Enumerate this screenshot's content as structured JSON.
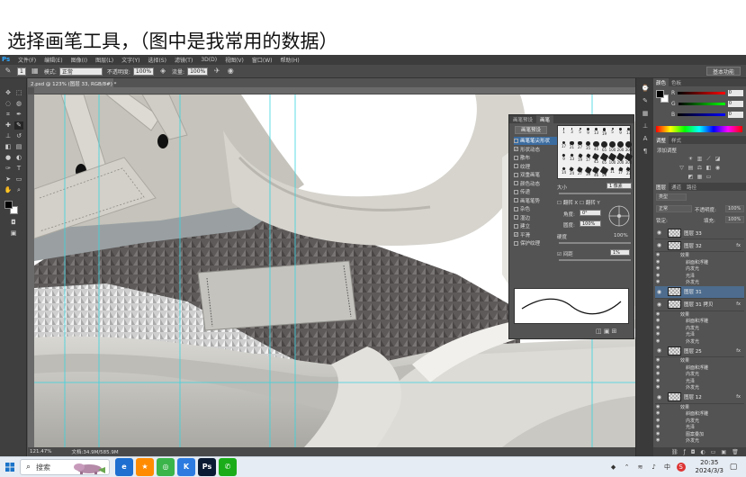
{
  "caption": "选择画笔工具，（图中是我常用的数据）",
  "ps": {
    "app_logo": "Ps",
    "menu": [
      "文件(F)",
      "编辑(E)",
      "图像(I)",
      "图层(L)",
      "文字(Y)",
      "选择(S)",
      "滤镜(T)",
      "3D(D)",
      "视图(V)",
      "窗口(W)",
      "帮助(H)"
    ],
    "options": {
      "brush_size": "1",
      "mode_label": "模式:",
      "mode_value": "正常",
      "opacity_label": "不透明度:",
      "opacity_value": "100%",
      "flow_label": "流量:",
      "flow_value": "100%"
    },
    "workspace_button": "基本功能",
    "document_tab": "2.psd @ 123% (图层 33, RGB/8#) *",
    "status": {
      "zoom": "121.47%",
      "doc_info": "文档:34.9M/585.9M"
    },
    "brush_panel": {
      "tabs": [
        "画笔预设",
        "画笔"
      ],
      "preset_button": "画笔预设",
      "categories": [
        {
          "label": "画笔笔尖形状",
          "checked": false,
          "selected": true
        },
        {
          "label": "形状动态",
          "checked": true,
          "selected": false
        },
        {
          "label": "散布",
          "checked": false,
          "selected": false
        },
        {
          "label": "纹理",
          "checked": false,
          "selected": false
        },
        {
          "label": "双重画笔",
          "checked": false,
          "selected": false
        },
        {
          "label": "颜色动态",
          "checked": false,
          "selected": false
        },
        {
          "label": "传递",
          "checked": false,
          "selected": false
        },
        {
          "label": "画笔笔势",
          "checked": false,
          "selected": false
        },
        {
          "label": "杂色",
          "checked": false,
          "selected": false
        },
        {
          "label": "湿边",
          "checked": false,
          "selected": false
        },
        {
          "label": "建立",
          "checked": false,
          "selected": false
        },
        {
          "label": "平滑",
          "checked": true,
          "selected": false
        },
        {
          "label": "保护纹理",
          "checked": false,
          "selected": false
        }
      ],
      "tips": [
        "1",
        "3",
        "5",
        "9",
        "13",
        "19",
        "5",
        "9",
        "13",
        "17",
        "21",
        "27",
        "35",
        "45",
        "65",
        "100",
        "200",
        "300",
        "9",
        "13",
        "19",
        "17",
        "45",
        "65",
        "100",
        "200",
        "300",
        "14",
        "24",
        "27",
        "39",
        "46",
        "59",
        "11",
        "17",
        "23"
      ],
      "size_label": "大小",
      "size_value": "1 像素",
      "flip_x_label": "翻转 X",
      "flip_y_label": "翻转 Y",
      "angle_label": "角度:",
      "angle_value": "0°",
      "roundness_label": "圆度:",
      "roundness_value": "100%",
      "hardness_label": "硬度",
      "hardness_value": "100%",
      "spacing_label": "间距",
      "spacing_value": "1%"
    },
    "color_panel": {
      "tabs": [
        "颜色",
        "色板"
      ],
      "r_label": "R",
      "r_value": "0",
      "g_label": "G",
      "g_value": "0",
      "b_label": "B",
      "b_value": "0"
    },
    "adjust_panel": {
      "tabs": [
        "调整",
        "样式"
      ],
      "add_label": "添加调整"
    },
    "layers_panel": {
      "tabs": [
        "图层",
        "通道",
        "路径"
      ],
      "kind_label": "类型",
      "blend_mode": "正常",
      "opacity_label": "不透明度:",
      "opacity_value": "100%",
      "lock_label": "锁定:",
      "fill_label": "填充:",
      "fill_value": "100%",
      "fx_mark": "fx",
      "rows": [
        {
          "type": "layer",
          "name": "图层 33",
          "selected": false,
          "fx": false
        },
        {
          "type": "layer",
          "name": "图层 32",
          "selected": false,
          "fx": true
        },
        {
          "type": "effect",
          "name": "效果",
          "level": 1
        },
        {
          "type": "effect",
          "name": "斜面和浮雕",
          "level": 2
        },
        {
          "type": "effect",
          "name": "内发光",
          "level": 2
        },
        {
          "type": "effect",
          "name": "光泽",
          "level": 2
        },
        {
          "type": "effect",
          "name": "外发光",
          "level": 2
        },
        {
          "type": "layer",
          "name": "图层 31",
          "selected": true,
          "fx": false
        },
        {
          "type": "layer",
          "name": "图层 31 拷贝",
          "selected": false,
          "fx": true
        },
        {
          "type": "effect",
          "name": "效果",
          "level": 1
        },
        {
          "type": "effect",
          "name": "斜面和浮雕",
          "level": 2
        },
        {
          "type": "effect",
          "name": "内发光",
          "level": 2
        },
        {
          "type": "effect",
          "name": "光泽",
          "level": 2
        },
        {
          "type": "effect",
          "name": "外发光",
          "level": 2
        },
        {
          "type": "layer",
          "name": "图层 25",
          "selected": false,
          "fx": true
        },
        {
          "type": "effect",
          "name": "效果",
          "level": 1
        },
        {
          "type": "effect",
          "name": "斜面和浮雕",
          "level": 2
        },
        {
          "type": "effect",
          "name": "内发光",
          "level": 2
        },
        {
          "type": "effect",
          "name": "光泽",
          "level": 2
        },
        {
          "type": "effect",
          "name": "外发光",
          "level": 2
        },
        {
          "type": "layer",
          "name": "图层 12",
          "selected": false,
          "fx": true
        },
        {
          "type": "effect",
          "name": "效果",
          "level": 1
        },
        {
          "type": "effect",
          "name": "斜面和浮雕",
          "level": 2
        },
        {
          "type": "effect",
          "name": "内发光",
          "level": 2
        },
        {
          "type": "effect",
          "name": "光泽",
          "level": 2
        },
        {
          "type": "effect",
          "name": "图案叠加",
          "level": 2
        },
        {
          "type": "effect",
          "name": "外发光",
          "level": 2
        }
      ]
    }
  },
  "taskbar": {
    "search_placeholder": "搜索",
    "time": "20:35",
    "date": "2024/3/3",
    "ime_label": "中",
    "apps": [
      {
        "name": "edge",
        "glyph": "e",
        "color": "#1e6fd0"
      },
      {
        "name": "store",
        "glyph": "★",
        "color": "#ff8c00"
      },
      {
        "name": "browser-360",
        "glyph": "◎",
        "color": "#3ab54a"
      },
      {
        "name": "app-k",
        "glyph": "K",
        "color": "#2d7be0"
      },
      {
        "name": "photoshop",
        "glyph": "Ps",
        "color": "#0b1a33"
      },
      {
        "name": "wechat",
        "glyph": "✆",
        "color": "#1aad19"
      }
    ]
  }
}
